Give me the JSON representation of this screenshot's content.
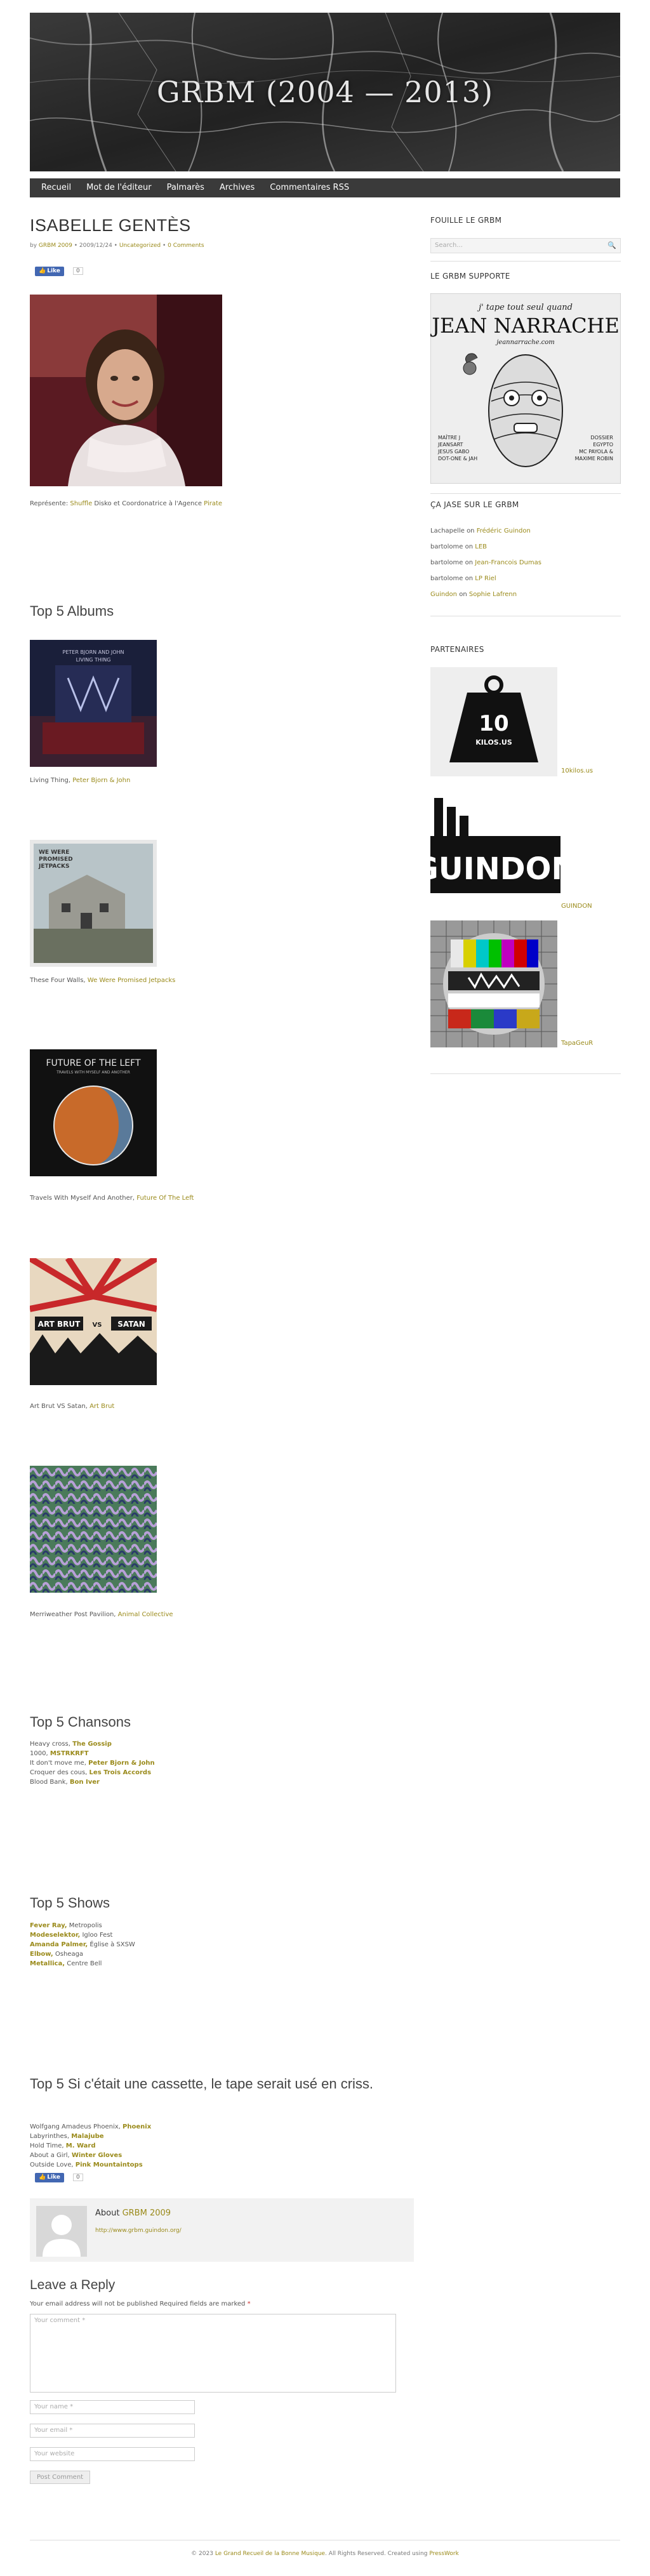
{
  "site": {
    "title": "GRBM (2004 — 2013)"
  },
  "nav": {
    "items": [
      {
        "label": "Recueil"
      },
      {
        "label": "Mot de l'éditeur"
      },
      {
        "label": "Palmarès"
      },
      {
        "label": "Archives"
      },
      {
        "label": "Commentaires RSS"
      }
    ]
  },
  "post": {
    "title": "ISABELLE GENTÈS",
    "meta": {
      "by": "by",
      "author": "GRBM 2009",
      "date": "2009/12/24",
      "category": "Uncategorized",
      "comments": "0 Comments"
    },
    "like_label": "Like",
    "like_count": "0",
    "intro": {
      "prefix": "Représente:",
      "brand": "Shuffle",
      "middle": "Disko et Coordonatrice à l'Agence",
      "agency": "Pirate"
    }
  },
  "albums": {
    "heading": "Top 5 Albums",
    "items": [
      {
        "title": "Living Thing,",
        "artist": "Peter Bjorn & John"
      },
      {
        "title": "These Four Walls,",
        "artist": "We Were Promised Jetpacks"
      },
      {
        "title": "Travels With Myself And Another,",
        "artist": "Future Of The Left"
      },
      {
        "title": "Art Brut VS Satan,",
        "artist": "Art Brut"
      },
      {
        "title": "Merriweather Post Pavilion,",
        "artist": "Animal Collective"
      }
    ],
    "covers": [
      {
        "lines": [
          "PETER BJORN AND JOHN",
          "LIVING THING"
        ]
      },
      {
        "lines": [
          "WE WERE",
          "PROMISED",
          "JETPACKS"
        ]
      },
      {
        "lines": [
          "FUTURE OF THE LEFT",
          "TRAVELS WITH MYSELF AND ANOTHER"
        ]
      },
      {
        "lines": [
          "ART BRUT",
          "VS",
          "SATAN"
        ]
      }
    ]
  },
  "songs": {
    "heading": "Top 5 Chansons",
    "items": [
      {
        "title": "Heavy cross,",
        "artist": "The Gossip"
      },
      {
        "title": "1000,",
        "artist": "MSTRKRFT"
      },
      {
        "title": "It don't move me,",
        "artist": "Peter Bjorn & John"
      },
      {
        "title": "Croquer des cous,",
        "artist": "Les Trois Accords"
      },
      {
        "title": "Blood Bank,",
        "artist": "Bon Iver"
      }
    ]
  },
  "shows": {
    "heading": "Top 5 Shows",
    "items": [
      {
        "artist": "Fever Ray,",
        "venue": "Metropolis"
      },
      {
        "artist": "Modeselektor,",
        "venue": "Igloo Fest"
      },
      {
        "artist": "Amanda Palmer,",
        "venue": "Église à SXSW"
      },
      {
        "artist": "Elbow,",
        "venue": "Osheaga"
      },
      {
        "artist": "Metallica,",
        "venue": "Centre Bell"
      }
    ]
  },
  "tape": {
    "heading": "Top 5 Si c'était une cassette, le tape serait usé en criss.",
    "items": [
      {
        "title": "Wolfgang Amadeus Phoenix,",
        "artist": "Phoenix"
      },
      {
        "title": "Labyrinthes,",
        "artist": "Malajube"
      },
      {
        "title": "Hold Time,",
        "artist": "M. Ward"
      },
      {
        "title": "About a Girl,",
        "artist": "Winter Gloves"
      },
      {
        "title": "Outside Love,",
        "artist": "Pink Mountaintops"
      }
    ]
  },
  "author_box": {
    "about": "About",
    "name": "GRBM 2009",
    "url": "http://www.grbm.guindon.org/"
  },
  "reply": {
    "heading": "Leave a Reply",
    "note": "Your email address will not be published Required fields are marked",
    "required_mark": "*",
    "comment_placeholder": "Your comment *",
    "name_placeholder": "Your name *",
    "email_placeholder": "Your email *",
    "website_placeholder": "Your website",
    "submit": "Post Comment"
  },
  "sidebar": {
    "search": {
      "title": "FOUILLE LE GRBM",
      "placeholder": "Search..."
    },
    "supports": {
      "title": "LE GRBM SUPPORTE",
      "poster": {
        "tagline": "j' tape tout seul quand",
        "name": "JEAN NARRACHE",
        "url": "jeannarrache.com",
        "left": [
          "MAÎTRE J",
          "JEANSART",
          "JESUS GABO",
          "DOT-ONE & JAH"
        ],
        "right": [
          "DOSSIER",
          "EGYPTO",
          "MC PAYOLA &",
          "MAXIME ROBIN"
        ]
      }
    },
    "comments": {
      "title": "ÇA JASE SUR LE GRBM",
      "items": [
        {
          "author": "Lachapelle",
          "on": "on",
          "post": "Frédéric Guindon"
        },
        {
          "author": "bartolome",
          "on": "on",
          "post": "LEB"
        },
        {
          "author": "bartolome",
          "on": "on",
          "post": "Jean-Francois Dumas"
        },
        {
          "author": "bartolome",
          "on": "on",
          "post": "LP Riel"
        },
        {
          "author": "Guindon",
          "on": "on",
          "post": "Sophie Lafrenn"
        }
      ]
    },
    "partners": {
      "title": "PARTENAIRES",
      "items": [
        {
          "label": "10kilos.us"
        },
        {
          "label": "GUINDON"
        },
        {
          "label": "TapaGeuR"
        }
      ],
      "weight_text": [
        "10",
        "KILOS.US"
      ],
      "guindon_logo": "GUINDON"
    }
  },
  "footer": {
    "prefix": "© 2023",
    "site": "Le Grand Recueil de la Bonne Musique",
    "middle": ". All Rights Reserved. Created using",
    "theme": "PressWork"
  }
}
